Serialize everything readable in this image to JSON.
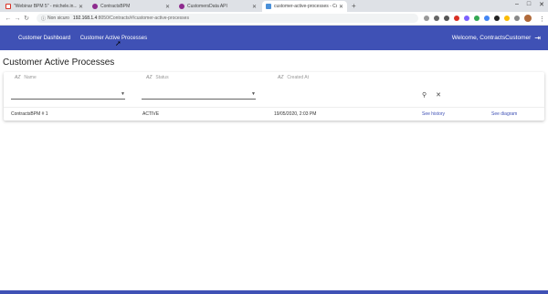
{
  "browser": {
    "tabs": [
      {
        "title": "\"Webinar BPM 5\" - michele.in...",
        "icon": "gmail-icon",
        "active": false
      },
      {
        "title": "ContractsBPM",
        "icon": "bpm-icon",
        "active": false
      },
      {
        "title": "CustomersData API",
        "icon": "bpm-icon",
        "active": false
      },
      {
        "title": "customer-active-processes - Co",
        "icon": "page-icon",
        "active": true
      }
    ],
    "security": "Non sicuro",
    "url_host": "192.168.1.4",
    "url_path": ":8050/Contracts/#/customer-active-processes"
  },
  "appbar": {
    "nav": [
      "Customer Dashboard",
      "Customer Active Processes"
    ],
    "welcome": "Welcome, ContractsCustomer"
  },
  "page": {
    "title": "Customer Active Processes"
  },
  "table": {
    "columns": [
      "Name",
      "Status",
      "Created At"
    ],
    "rows": [
      {
        "name": "ContractsBPM # 1",
        "status": "ACTIVE",
        "created": "19/05/2020, 2:03 PM",
        "history": "See history",
        "diagram": "See diagram"
      }
    ]
  },
  "colors": {
    "primary": "#3f51b5"
  }
}
